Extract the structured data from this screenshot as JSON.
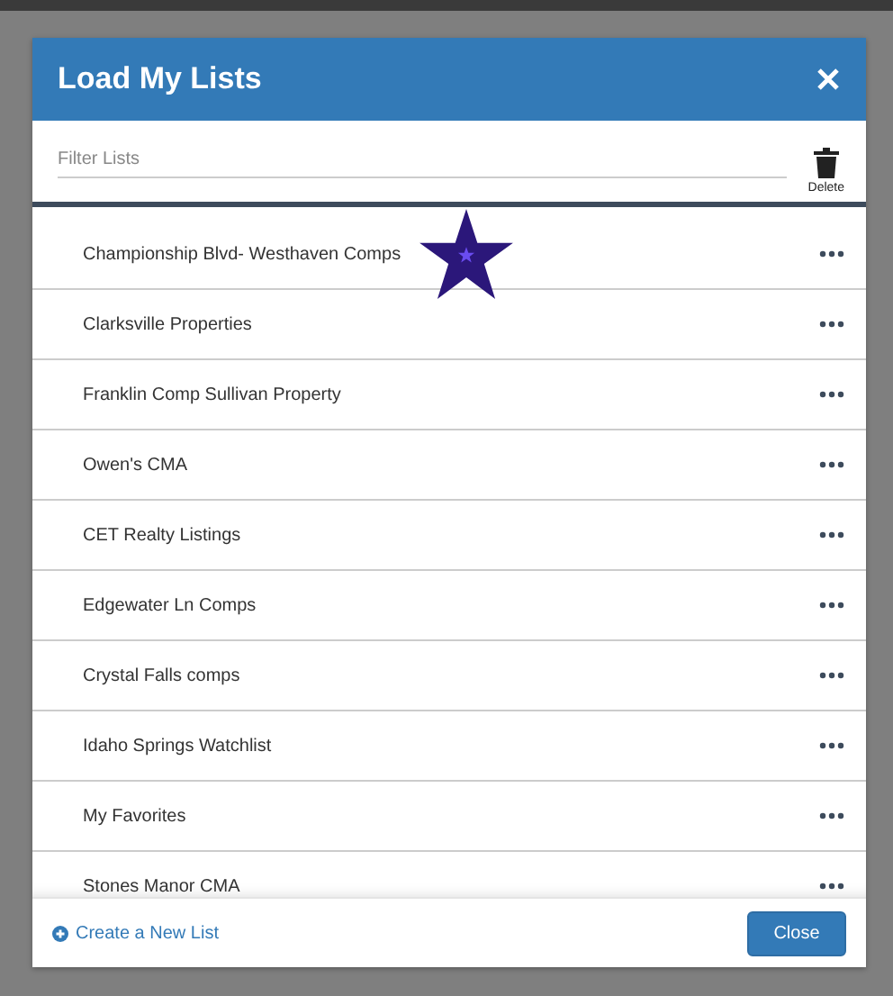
{
  "dialog": {
    "title": "Load My Lists",
    "filter": {
      "placeholder": "Filter Lists"
    },
    "delete_label": "Delete",
    "lists": [
      {
        "name": "Championship Blvd- Westhaven Comps",
        "starred": true
      },
      {
        "name": "Clarksville Properties",
        "starred": false
      },
      {
        "name": "Franklin Comp Sullivan Property",
        "starred": false
      },
      {
        "name": "Owen's CMA",
        "starred": false
      },
      {
        "name": "CET Realty Listings",
        "starred": false
      },
      {
        "name": "Edgewater Ln Comps",
        "starred": false
      },
      {
        "name": "Crystal Falls comps",
        "starred": false
      },
      {
        "name": "Idaho Springs Watchlist",
        "starred": false
      },
      {
        "name": "My Favorites",
        "starred": false
      },
      {
        "name": "Stones Manor CMA",
        "starred": false
      }
    ],
    "create_link": "Create a New List",
    "close_button": "Close"
  }
}
